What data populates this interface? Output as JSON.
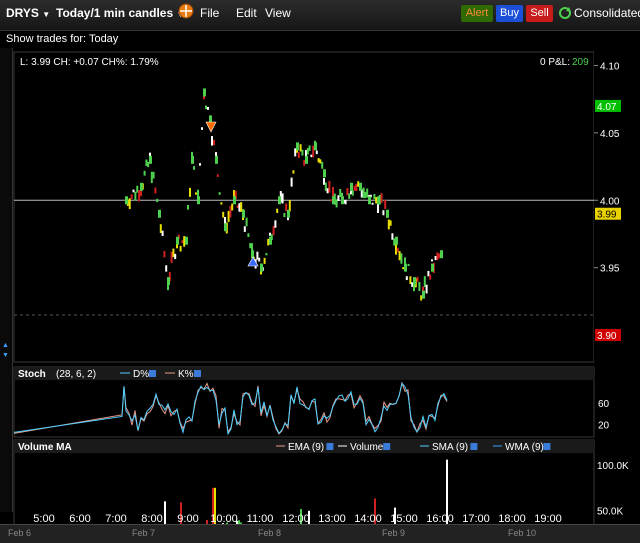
{
  "titlebar": {
    "symbol": "DRYS",
    "timeframe": "Today/1 min candles",
    "menu": [
      {
        "label": "File",
        "key": "F"
      },
      {
        "label": "Edit",
        "key": "E"
      },
      {
        "label": "View",
        "key": "V"
      }
    ],
    "alert_label": "Alert",
    "buy_label": "Buy",
    "sell_label": "Sell",
    "consolidated_label": "Consolidated",
    "colors": {
      "alert": "#2e6a00",
      "buy": "#1b4fd8",
      "sell": "#c81b1b"
    }
  },
  "subbar": {
    "show_trades": "Show trades for:  Today"
  },
  "price_panel": {
    "info": "L: 3.99 CH: +0.07 CH%: 1.79%",
    "pnl_label": "0 P&L:",
    "pnl_value": "209",
    "tick_labels": [
      "4.10",
      "4.05",
      "4.00",
      "3.95"
    ],
    "badges": [
      {
        "text": "4.07",
        "color": "#00c000"
      },
      {
        "text": "3.99",
        "color": "#e8d200"
      },
      {
        "text": "3.90",
        "color": "#d00000"
      }
    ]
  },
  "stoch_panel": {
    "title": "Stoch",
    "params": "(28, 6, 2)",
    "legend": [
      "D%",
      "K%"
    ],
    "tick_labels": [
      "60",
      "20"
    ]
  },
  "volume_panel": {
    "title": "Volume MA",
    "legend": [
      "EMA (9)",
      "Volume",
      "SMA (9)",
      "WMA (9)"
    ],
    "tick_labels": [
      "100.0K",
      "50.0K"
    ]
  },
  "time_axis": {
    "labels": [
      "5:00",
      "6:00",
      "7:00",
      "8:00",
      "9:00",
      "10:00",
      "11:00",
      "12:00",
      "13:00",
      "14:00",
      "15:00",
      "16:00",
      "17:00",
      "18:00",
      "19:00"
    ]
  },
  "date_strip": {
    "labels": [
      "Feb 6",
      "Feb 7",
      "Feb 8",
      "Feb 9",
      "Feb 10"
    ]
  },
  "chart_data": {
    "type": "line",
    "title": "DRYS Today/1 min candles",
    "ylim": [
      3.88,
      4.11
    ],
    "x": [
      "7:15",
      "7:40",
      "7:55",
      "8:10",
      "8:25",
      "8:40",
      "8:55",
      "9:05",
      "9:15",
      "9:25",
      "9:35",
      "9:45",
      "10:00",
      "10:15",
      "10:30",
      "10:45",
      "11:00",
      "11:15",
      "11:30",
      "11:45",
      "12:00",
      "12:15",
      "12:30",
      "12:45",
      "13:00",
      "13:15",
      "13:30",
      "13:45",
      "14:00",
      "14:15",
      "14:30",
      "14:45",
      "15:00",
      "15:15",
      "15:30",
      "15:45",
      "16:00"
    ],
    "series": [
      {
        "values": [
          4.0,
          4.01,
          4.03,
          3.99,
          3.94,
          3.97,
          3.97,
          4.03,
          4.0,
          4.08,
          4.06,
          4.03,
          3.98,
          4.0,
          3.99,
          3.96,
          3.95,
          3.97,
          4.0,
          3.99,
          4.04,
          4.03,
          4.04,
          4.02,
          4.0,
          4.0,
          4.01,
          4.01,
          4.0,
          4.0,
          3.99,
          3.97,
          3.95,
          3.94,
          3.93,
          3.95,
          3.96
        ]
      }
    ]
  }
}
